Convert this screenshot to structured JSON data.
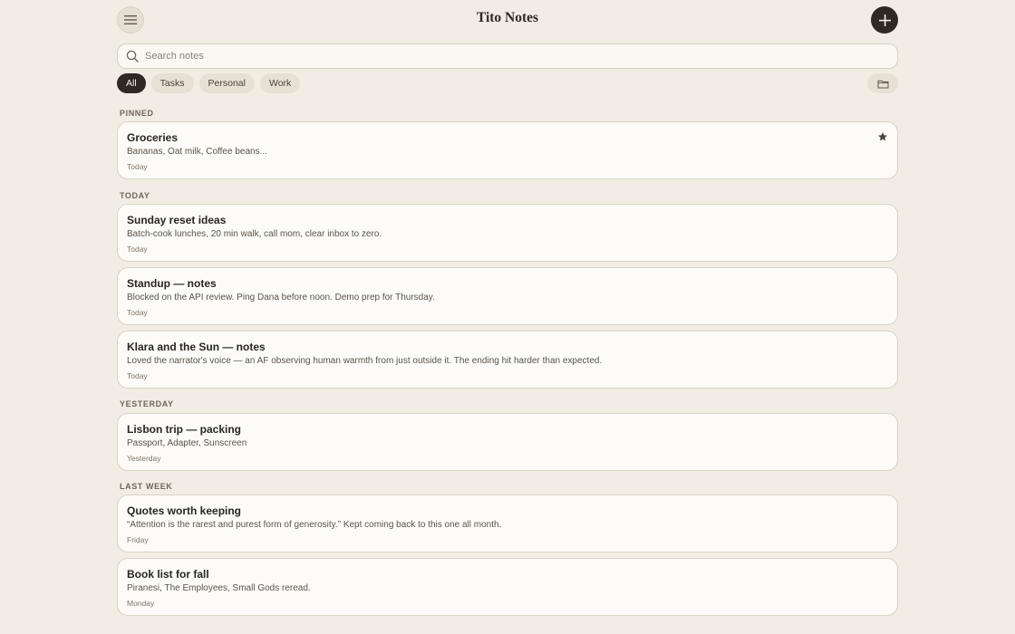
{
  "header": {
    "title": "Tito Notes",
    "menu_icon": "hamburger-icon",
    "add_icon": "plus-icon"
  },
  "search": {
    "placeholder": "Search notes",
    "value": ""
  },
  "filters": [
    {
      "label": "All",
      "active": true
    },
    {
      "label": "Tasks",
      "active": false
    },
    {
      "label": "Personal",
      "active": false
    },
    {
      "label": "Work",
      "active": false
    }
  ],
  "folder_icon": "folder-icon",
  "sections": {
    "pinned": "PINNED",
    "today": "TODAY",
    "yesterday": "YESTERDAY",
    "last_week": "LAST WEEK"
  },
  "notes": [
    {
      "title": "Groceries",
      "body": "Bananas, Oat milk, Coffee beans...",
      "date": "Today",
      "pinned": true
    },
    {
      "title": "Sunday reset ideas",
      "body": "Batch-cook lunches, 20 min walk, call mom, clear inbox to zero.",
      "date": "Today"
    },
    {
      "title": "Standup — notes",
      "body": "Blocked on the API review. Ping Dana before noon. Demo prep for Thursday.",
      "date": "Today"
    },
    {
      "title": "Klara and the Sun — notes",
      "body": "Loved the narrator's voice — an AF observing human warmth from just outside it. The ending hit harder than expected.",
      "date": "Today"
    },
    {
      "title": "Lisbon trip — packing",
      "body": "Passport, Adapter, Sunscreen",
      "date": "Yesterday"
    },
    {
      "title": "Quotes worth keeping",
      "body": "“Attention is the rarest and purest form of generosity.” Kept coming back to this one all month.",
      "date": "Friday"
    },
    {
      "title": "Book list for fall",
      "body": "Piranesi, The Employees, Small Gods reread.",
      "date": "Monday"
    }
  ],
  "colors": {
    "background": "#f2ede4",
    "accent": "#2f2923",
    "card": "#fdfbf7"
  }
}
